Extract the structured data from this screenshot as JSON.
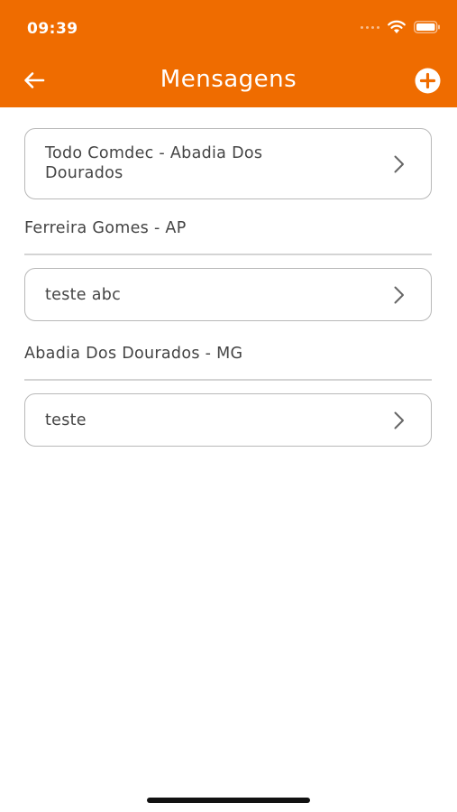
{
  "status_bar": {
    "time": "09:39"
  },
  "app_bar": {
    "title": "Mensagens"
  },
  "messages": {
    "item1": {
      "line1": "Todo Comdec - Abadia Dos",
      "line2": "Dourados"
    },
    "group1": {
      "title": "Ferreira Gomes - AP",
      "items": [
        {
          "label": "teste abc"
        }
      ]
    },
    "group2": {
      "title": "Abadia Dos Dourados - MG",
      "items": [
        {
          "label": "teste"
        }
      ]
    }
  },
  "colors": {
    "accent": "#ef6c00",
    "card_border": "#b8b8b8",
    "divider": "#d4d4d4"
  },
  "icons": [
    "back-arrow-icon",
    "add-circle-icon",
    "chevron-right-icon",
    "wifi-icon",
    "battery-icon"
  ]
}
